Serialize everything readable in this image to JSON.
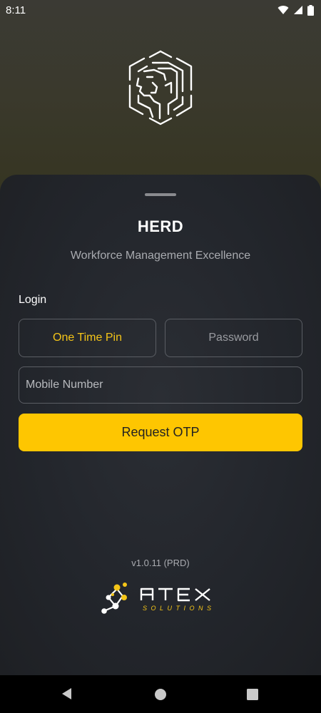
{
  "status_bar": {
    "time": "8:11",
    "icons": [
      "wifi-icon",
      "signal-icon",
      "battery-icon"
    ]
  },
  "logo": {
    "icon": "lion-logo-icon"
  },
  "app": {
    "title": "HERD",
    "subtitle": "Workforce Management Excellence"
  },
  "login": {
    "label": "Login",
    "tabs": [
      {
        "label": "One Time Pin",
        "active": true
      },
      {
        "label": "Password",
        "active": false
      }
    ],
    "mobile_placeholder": "Mobile Number",
    "mobile_value": "",
    "request_button": "Request OTP"
  },
  "footer": {
    "version": "v1.0.11 (PRD)",
    "brand_logo_text": "ATEX SOLUTIONS"
  },
  "nav": {
    "icons": [
      "back-icon",
      "home-icon",
      "recents-icon"
    ]
  },
  "colors": {
    "accent": "#FEC601",
    "accent_text": "#F5C518",
    "sheet": "#23262C",
    "border": "#5B5E64"
  }
}
